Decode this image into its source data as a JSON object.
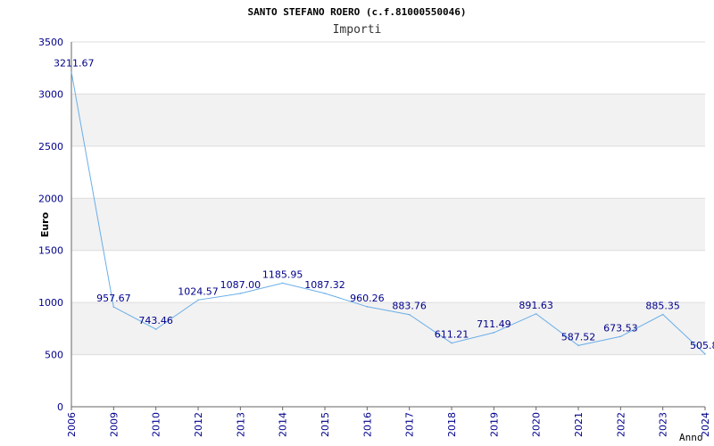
{
  "chart_data": {
    "type": "line",
    "title": "SANTO STEFANO ROERO (c.f.81000550046)",
    "subtitle": "Importi",
    "xlabel": "Anno",
    "ylabel": "Euro",
    "ylim": [
      0,
      3500
    ],
    "yticks": [
      0,
      500,
      1000,
      1500,
      2000,
      2500,
      3000,
      3500
    ],
    "ytick_labels": [
      "0",
      "500",
      "1000",
      "1500",
      "2000",
      "2500",
      "3000",
      "3500"
    ],
    "grid": "alternating horizontal bands",
    "colors": {
      "line": "#6aaee8",
      "band": "#f2f2f2",
      "text": "#00008b",
      "axis": "#666666"
    },
    "categories": [
      "2006",
      "2009",
      "2010",
      "2012",
      "2013",
      "2014",
      "2015",
      "2016",
      "2017",
      "2018",
      "2019",
      "2020",
      "2021",
      "2022",
      "2023",
      "2024"
    ],
    "values": [
      3211.67,
      957.67,
      743.46,
      1024.57,
      1087.0,
      1185.95,
      1087.32,
      960.26,
      883.76,
      611.21,
      711.49,
      891.63,
      587.52,
      673.53,
      885.35,
      505.8
    ],
    "value_labels": [
      "3211.67",
      "957.67",
      "743.46",
      "1024.57",
      "1087.00",
      "1185.95",
      "1087.32",
      "960.26",
      "883.76",
      "611.21",
      "711.49",
      "891.63",
      "587.52",
      "673.53",
      "885.35",
      "505.8"
    ]
  }
}
